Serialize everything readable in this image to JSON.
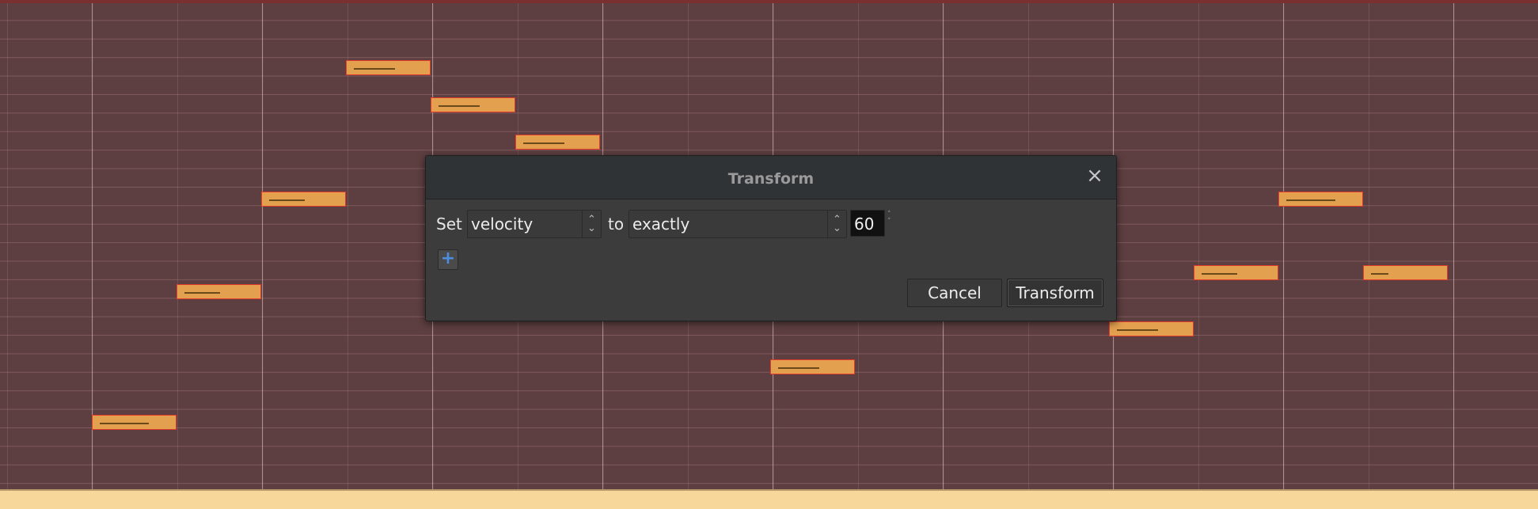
{
  "dialog": {
    "title": "Transform",
    "close_icon": "×",
    "set_label": "Set",
    "property_select": {
      "selected": "velocity"
    },
    "to_label": "to",
    "operation_select": {
      "selected": "exactly"
    },
    "value": "60",
    "add_icon": "+",
    "cancel_label": "Cancel",
    "transform_label": "Transform"
  },
  "colors": {
    "note_fill": "#e3a04f",
    "note_border": "#e23a2a",
    "roll_background": "#5e3f41",
    "dialog_background": "#3c3c3c",
    "add_icon": "#4a8ee0"
  },
  "icons": {
    "close": "close-icon",
    "add": "plus-icon",
    "combo_arrows": "up-down-chevron-icon"
  }
}
